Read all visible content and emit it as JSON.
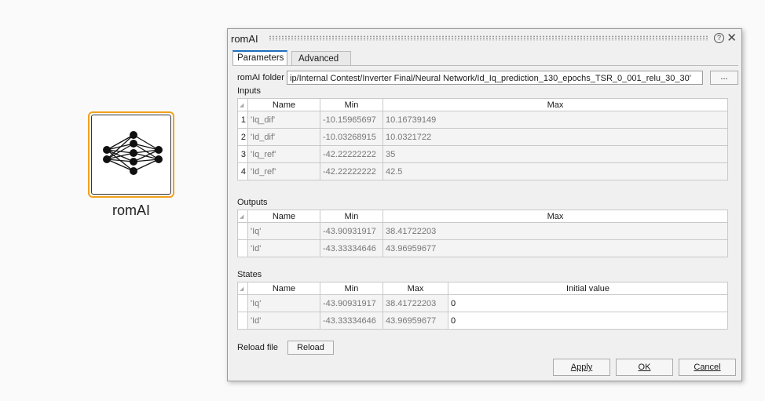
{
  "block": {
    "label": "romAI",
    "icon": "neural-network-icon"
  },
  "dialog": {
    "title": "romAI",
    "help_glyph": "?",
    "close_glyph": "✕",
    "tabs": [
      {
        "label": "Parameters",
        "active": true
      },
      {
        "label": "Advanced",
        "active": false
      }
    ],
    "folder": {
      "label": "romAI folder",
      "value": "ip/Internal Contest/Inverter Final/Neural Network/Id_Iq_prediction_130_epochs_TSR_0_001_relu_30_30'",
      "browse_label": "..."
    },
    "inputs": {
      "label": "Inputs",
      "corner": "◢",
      "columns": [
        "Name",
        "Min",
        "Max"
      ],
      "rows": [
        {
          "idx": "1",
          "name": "'Iq_dif'",
          "min": "-10.15965697",
          "max": "10.16739149"
        },
        {
          "idx": "2",
          "name": "'Id_dif'",
          "min": "-10.03268915",
          "max": "10.0321722"
        },
        {
          "idx": "3",
          "name": "'Iq_ref'",
          "min": "-42.22222222",
          "max": "35"
        },
        {
          "idx": "4",
          "name": "'Id_ref'",
          "min": "-42.22222222",
          "max": "42.5"
        }
      ]
    },
    "outputs": {
      "label": "Outputs",
      "corner": "◢",
      "columns": [
        "Name",
        "Min",
        "Max"
      ],
      "rows": [
        {
          "idx": "",
          "name": "'Iq'",
          "min": "-43.90931917",
          "max": "38.41722203"
        },
        {
          "idx": "",
          "name": "'Id'",
          "min": "-43.33334646",
          "max": "43.96959677"
        }
      ]
    },
    "states": {
      "label": "States",
      "corner": "◢",
      "columns": [
        "Name",
        "Min",
        "Max",
        "Initial value"
      ],
      "rows": [
        {
          "idx": "",
          "name": "'Iq'",
          "min": "-43.90931917",
          "max": "38.41722203",
          "init": "0"
        },
        {
          "idx": "",
          "name": "'Id'",
          "min": "-43.33334646",
          "max": "43.96959677",
          "init": "0"
        }
      ]
    },
    "reload": {
      "label": "Reload file",
      "button": "Reload"
    },
    "footer": {
      "apply_label": "Apply",
      "ok_label": "OK",
      "cancel_label": "Cancel"
    }
  },
  "colors": {
    "accent_tab": "#1e6fbf",
    "block_border": "#f2a11c"
  }
}
